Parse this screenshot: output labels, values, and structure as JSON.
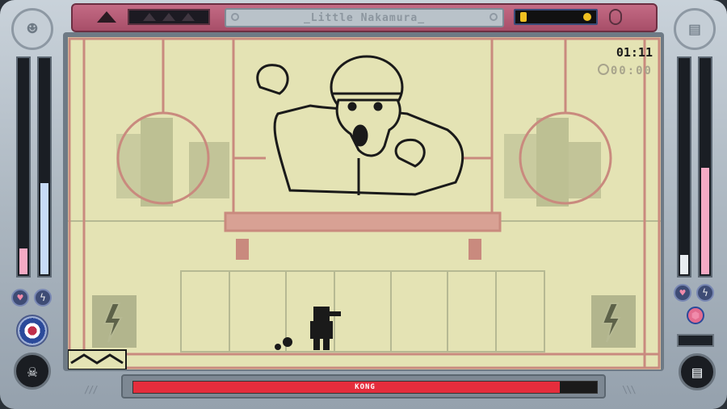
{
  "game": {
    "title": "_Little Nakamura_",
    "timer": "01:11",
    "stopwatch": "00:00"
  },
  "boss": {
    "name": "KONG",
    "health": 0.92
  },
  "colors": {
    "screen_bg": "#e4e3b4",
    "scaffold": "#c98a7e",
    "bg_art": "#b6b993",
    "ink": "#1a1a1a",
    "topbar": "#b35673",
    "boss_bar": "#e52d3c",
    "meter_pink": "#f4aac4",
    "meter_blue": "#c7dbf7"
  },
  "player": {
    "left_meter_pink": 0.12,
    "left_meter_blue": 0.42,
    "right_meter_pink": 0.49,
    "right_meter_white": 0.09
  },
  "icons": {
    "left_portrait": "ninja-face-icon",
    "right_portrait": "document-icon",
    "heart": "heart-icon",
    "bolt": "lightning-icon",
    "face": "skull-mask-icon"
  }
}
